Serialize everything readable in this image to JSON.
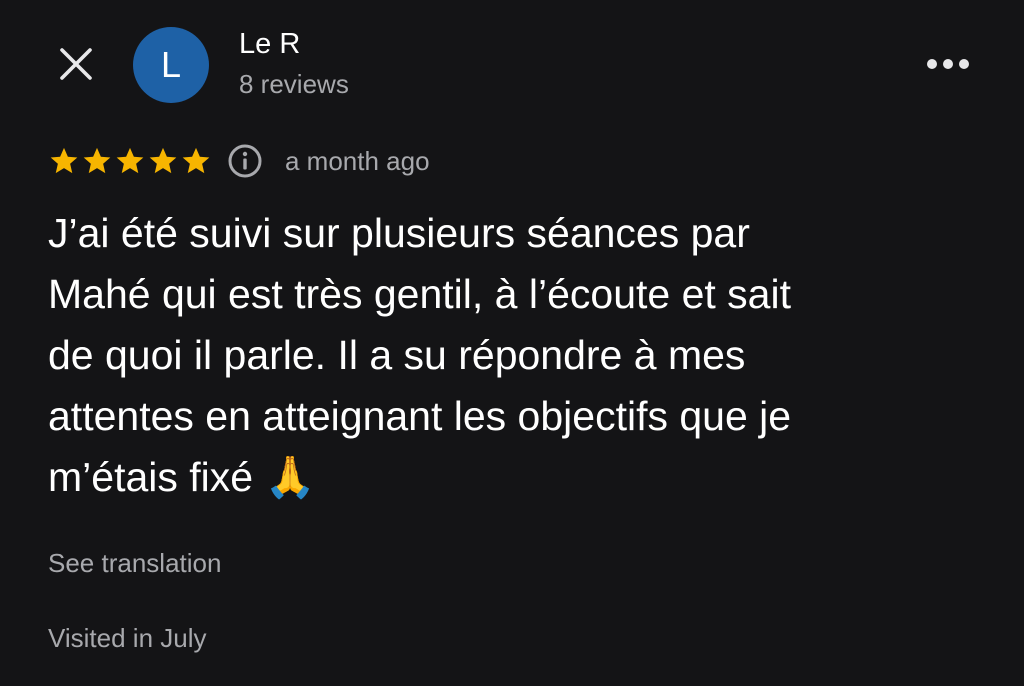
{
  "header": {
    "close_icon": "close-icon",
    "avatar_letter": "L",
    "avatar_color": "#1e61a6",
    "reviewer_name": "Le R",
    "review_count": "8 reviews",
    "more_icon": "more-horizontal-icon"
  },
  "rating": {
    "stars": 5,
    "max_stars": 5,
    "star_color": "#f7b500",
    "info_icon": "info-icon",
    "time": "a month ago"
  },
  "review": {
    "text": "J’ai été suivi sur plusieurs séances par\nMahé qui est très gentil, à l’écoute et sait\nde quoi il parle. Il a su répondre à mes\nattentes en atteignant les objectifs que je\nm’étais fixé 🙏"
  },
  "footer": {
    "see_translation": "See translation",
    "visited": "Visited in July"
  },
  "colors": {
    "background": "#141416",
    "text_primary": "#ffffff",
    "text_secondary": "#a8a9ad"
  }
}
